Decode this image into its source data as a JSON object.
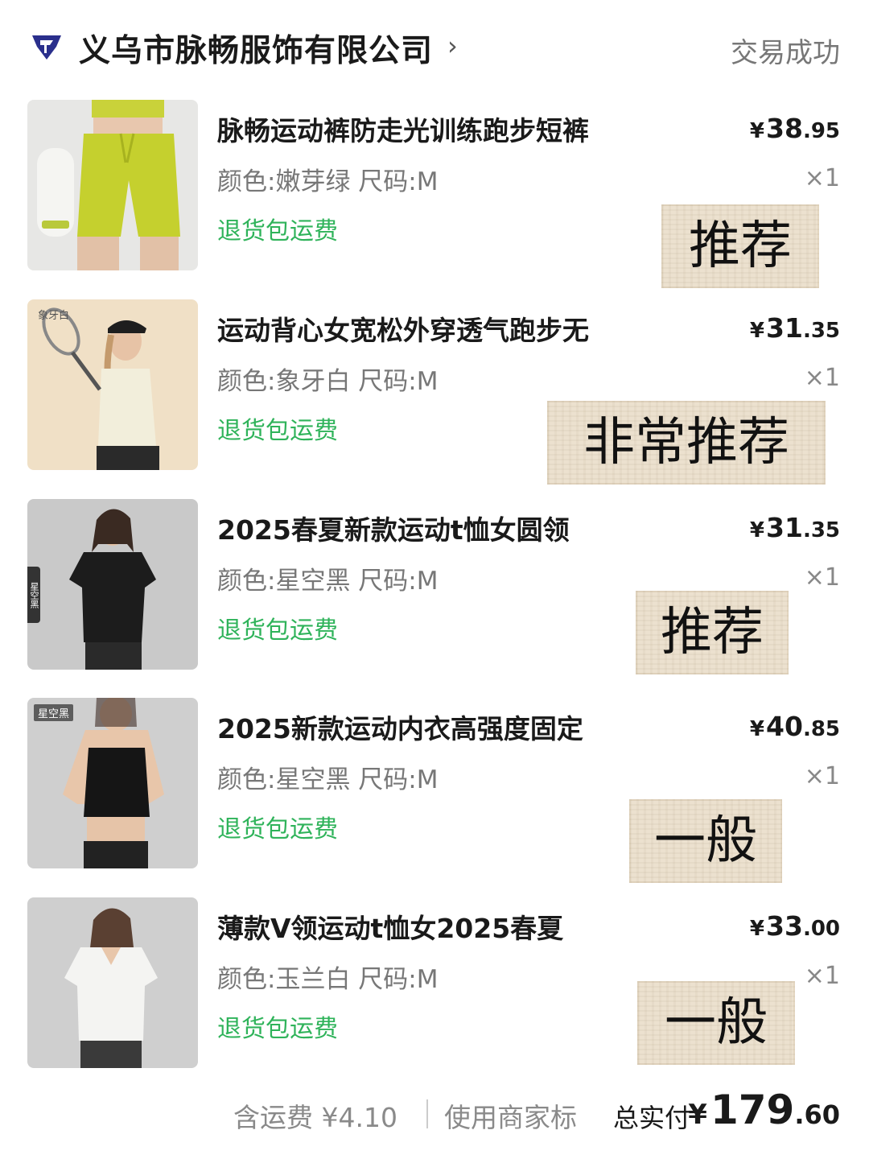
{
  "shop": {
    "name": "义乌市脉畅服饰有限公司",
    "chevron": "›",
    "status": "交易成功",
    "logo_icon": "shop-logo-icon"
  },
  "items": [
    {
      "title": "脉畅运动裤防走光训练跑步短裤",
      "spec": "颜色:嫩芽绿 尺码:M",
      "badge": "退货包运费",
      "price_symbol": "¥",
      "price_int": "38",
      "price_dec": ".95",
      "qty": "×1",
      "note": "推荐",
      "thumb_tag": ""
    },
    {
      "title": "运动背心女宽松外穿透气跑步无",
      "spec": "颜色:象牙白 尺码:M",
      "badge": "退货包运费",
      "price_symbol": "¥",
      "price_int": "31",
      "price_dec": ".35",
      "qty": "×1",
      "note": "非常推荐",
      "thumb_tag": "象牙白"
    },
    {
      "title": "2025春夏新款运动t恤女圆领",
      "spec": "颜色:星空黑 尺码:M",
      "badge": "退货包运费",
      "price_symbol": "¥",
      "price_int": "31",
      "price_dec": ".35",
      "qty": "×1",
      "note": "推荐",
      "thumb_tag": "星空黑"
    },
    {
      "title": "2025新款运动内衣高强度固定",
      "spec": "颜色:星空黑 尺码:M",
      "badge": "退货包运费",
      "price_symbol": "¥",
      "price_int": "40",
      "price_dec": ".85",
      "qty": "×1",
      "note": "一般",
      "thumb_tag": "星空黑"
    },
    {
      "title": "薄款V领运动t恤女2025春夏",
      "spec": "颜色:玉兰白 尺码:M",
      "badge": "退货包运费",
      "price_symbol": "¥",
      "price_int": "33",
      "price_dec": ".00",
      "qty": "×1",
      "note": "一般",
      "thumb_tag": ""
    }
  ],
  "footer": {
    "shipping": "含运费 ¥4.10",
    "merchant": "使用商家标",
    "total_label": "总实付",
    "total_symbol": "¥",
    "total_int": "179",
    "total_dec": ".60"
  },
  "colors": {
    "return_badge": "#2fb35a",
    "note_paper": "#ece1cf",
    "logo": "#2a2f8c"
  }
}
